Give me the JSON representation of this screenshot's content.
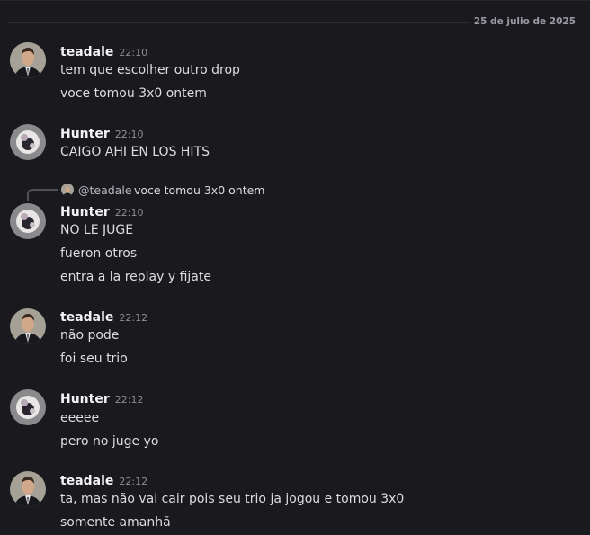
{
  "date_divider": "25 de julio de 2025",
  "messages": [
    {
      "author": "teadale",
      "time": "22:10",
      "lines": [
        "tem que escolher outro drop",
        "voce tomou 3x0 ontem"
      ]
    },
    {
      "author": "Hunter",
      "time": "22:10",
      "lines": [
        "CAIGO AHI EN LOS HITS"
      ]
    },
    {
      "reply": {
        "user": "@teadale",
        "text": "voce tomou 3x0 ontem"
      },
      "author": "Hunter",
      "time": "22:10",
      "lines": [
        "NO LE JUGE",
        "fueron otros",
        "entra a la replay y fijate"
      ]
    },
    {
      "author": "teadale",
      "time": "22:12",
      "lines": [
        "não pode",
        "foi seu trio"
      ]
    },
    {
      "author": "Hunter",
      "time": "22:12",
      "lines": [
        "eeeee",
        "pero no juge yo"
      ]
    },
    {
      "author": "teadale",
      "time": "22:12",
      "lines": [
        "ta, mas não vai cair pois seu trio ja jogou e tomou 3x0",
        "somente amanhã"
      ]
    }
  ],
  "colors": {
    "background": "#1a1a1e",
    "author": "#f2f3f5",
    "text": "#dcdde1",
    "timestamp": "#8d8d96"
  }
}
